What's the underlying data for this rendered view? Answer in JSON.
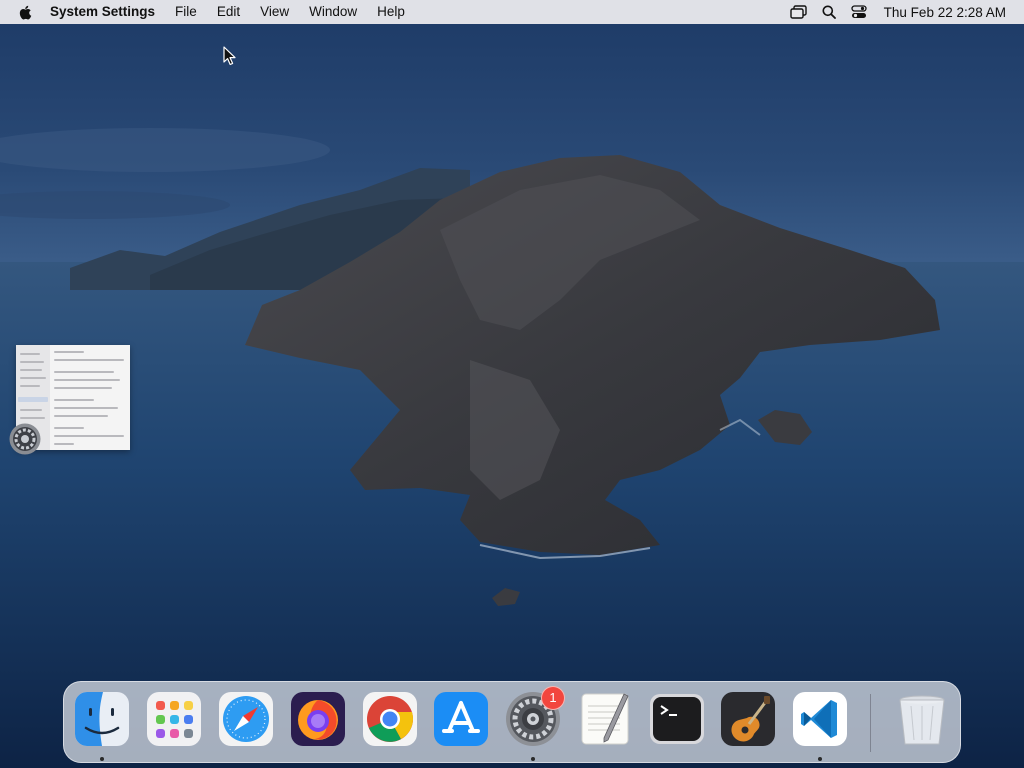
{
  "menubar": {
    "apple_icon": "apple-logo-icon",
    "app_name": "System Settings",
    "menus": [
      "File",
      "Edit",
      "View",
      "Window",
      "Help"
    ],
    "status_icons": [
      "screen-mirroring-icon",
      "spotlight-search-icon",
      "control-center-icon"
    ],
    "clock": "Thu Feb 22  2:28 AM"
  },
  "desktop": {
    "wallpaper": "macOS Catalina island"
  },
  "minimized_window": {
    "app": "System Settings",
    "app_icon": "system-settings-icon"
  },
  "dock": {
    "items": [
      {
        "name": "Finder",
        "icon": "finder-icon",
        "running": true
      },
      {
        "name": "Launchpad",
        "icon": "launchpad-icon",
        "running": false
      },
      {
        "name": "Safari",
        "icon": "safari-icon",
        "running": false
      },
      {
        "name": "Firefox",
        "icon": "firefox-icon",
        "running": false
      },
      {
        "name": "Google Chrome",
        "icon": "chrome-icon",
        "running": false
      },
      {
        "name": "App Store",
        "icon": "app-store-icon",
        "running": false
      },
      {
        "name": "System Settings",
        "icon": "system-settings-icon",
        "running": true,
        "badge": "1"
      },
      {
        "name": "TextEdit",
        "icon": "textedit-icon",
        "running": false
      },
      {
        "name": "Terminal",
        "icon": "terminal-icon",
        "running": false
      },
      {
        "name": "GarageBand",
        "icon": "garageband-icon",
        "running": false
      },
      {
        "name": "Visual Studio Code",
        "icon": "vscode-icon",
        "running": true
      },
      {
        "name": "Trash",
        "icon": "trash-icon",
        "running": false
      }
    ]
  },
  "colors": {
    "menubar_bg": "#e8e8ec",
    "dock_bg": "#e1e4ec",
    "badge": "#f2463e",
    "sky": "#2a4a76",
    "sea": "#122b4f"
  }
}
